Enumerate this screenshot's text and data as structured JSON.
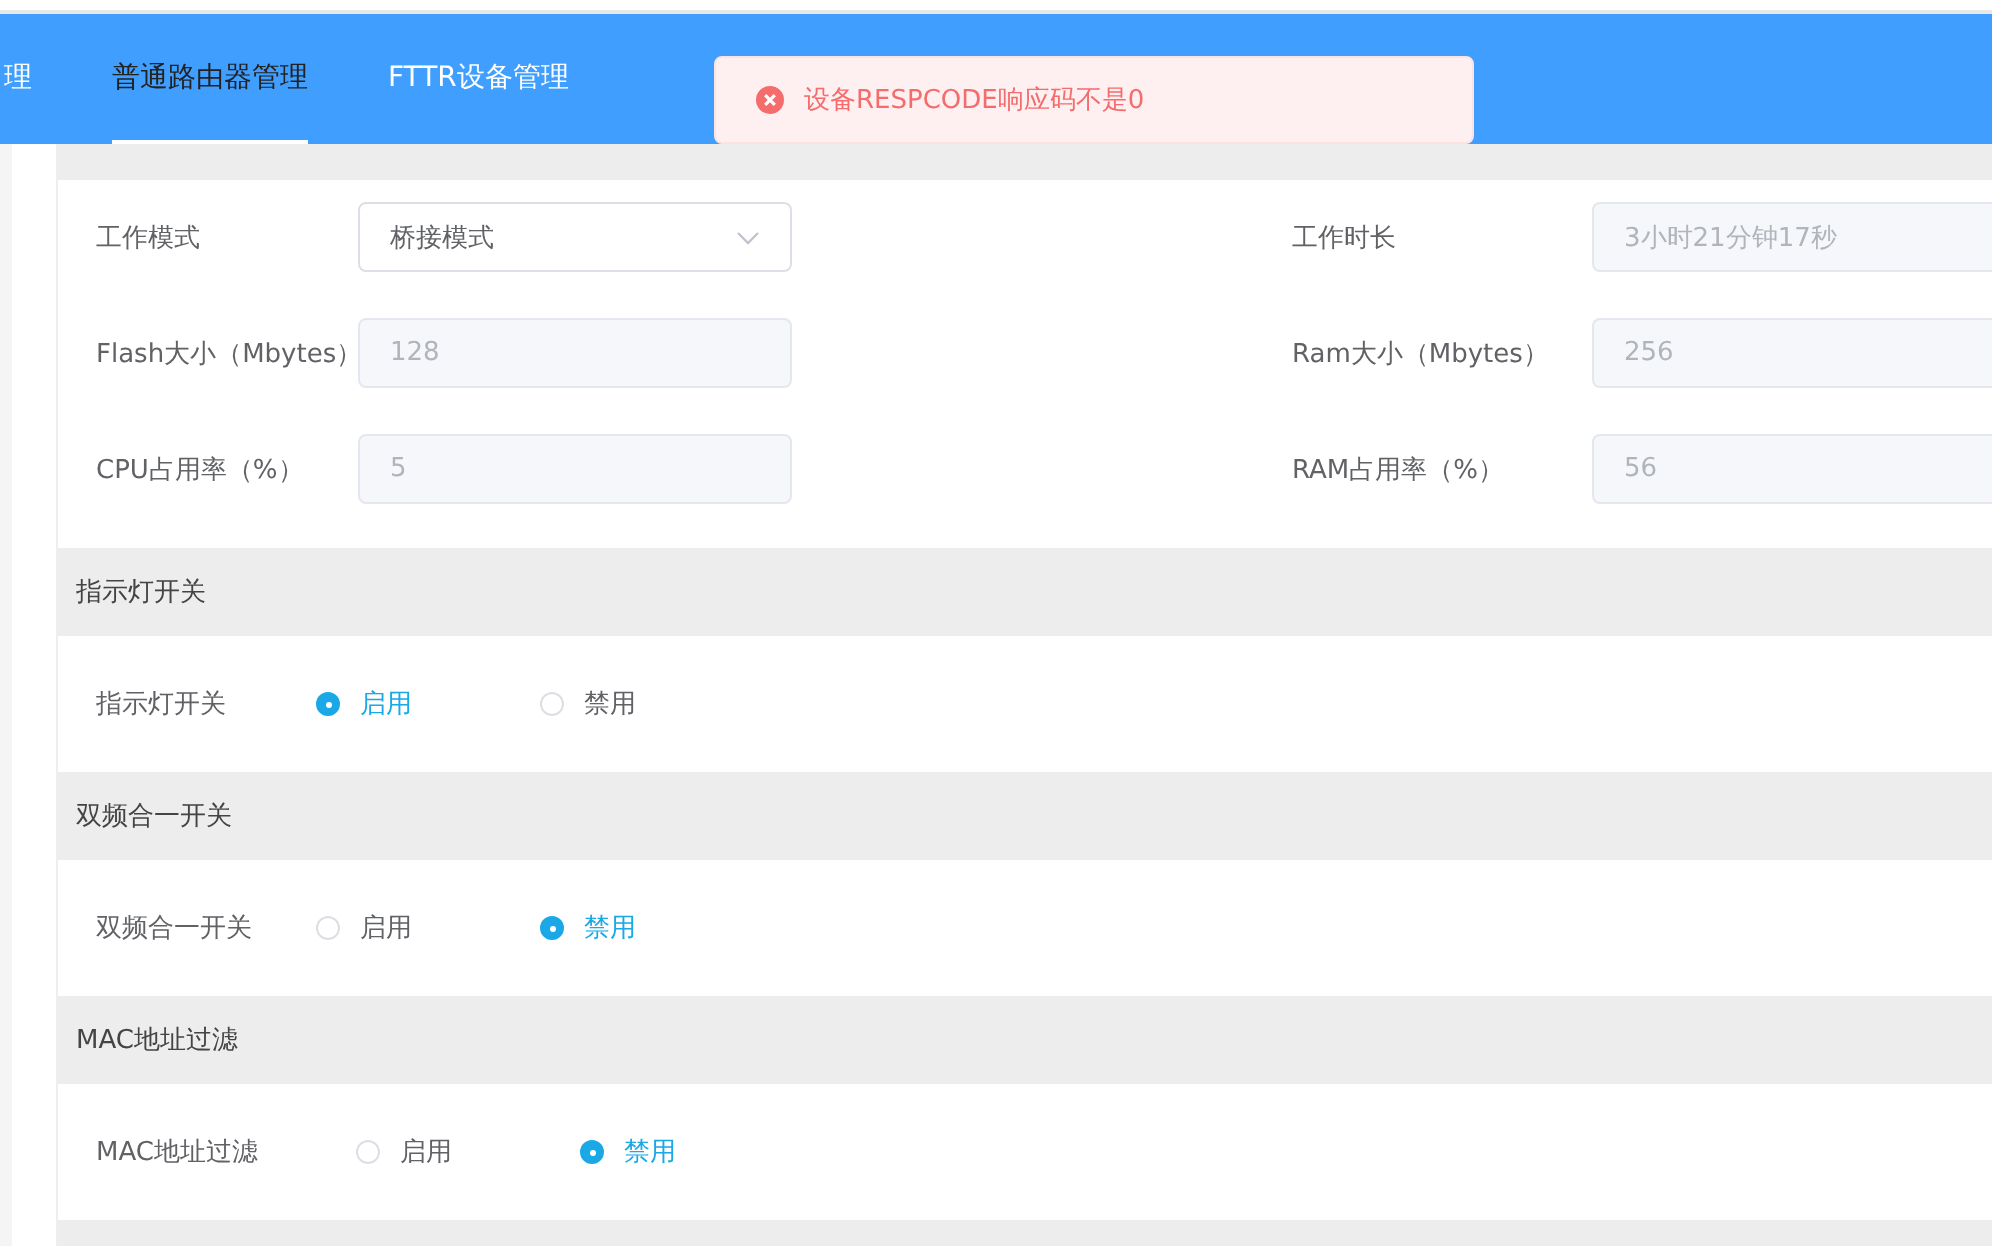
{
  "tabs": [
    {
      "label": "理",
      "selected": false
    },
    {
      "label": "普通路由器管理",
      "selected": true
    },
    {
      "label": "FTTR设备管理",
      "selected": false
    }
  ],
  "toast": {
    "kind": "error",
    "message": "设备RESPCODE响应码不是0"
  },
  "fields": [
    {
      "label": "工作模式",
      "value": "桥接模式",
      "kind": "select",
      "disabled": false
    },
    {
      "label": "工作时长",
      "value": "3小时21分钟17秒",
      "kind": "text",
      "disabled": true
    },
    {
      "label": "Flash大小（Mbytes）",
      "value": "128",
      "kind": "text",
      "disabled": true
    },
    {
      "label": "Ram大小（Mbytes）",
      "value": "256",
      "kind": "text",
      "disabled": true
    },
    {
      "label": "CPU占用率（%）",
      "value": "5",
      "kind": "text",
      "disabled": true
    },
    {
      "label": "RAM占用率（%）",
      "value": "56",
      "kind": "text",
      "disabled": true
    }
  ],
  "sections": [
    {
      "title": "指示灯开关",
      "label": "指示灯开关",
      "options": [
        {
          "label": "启用",
          "selected": true
        },
        {
          "label": "禁用",
          "selected": false
        }
      ]
    },
    {
      "title": "双频合一开关",
      "label": "双频合一开关",
      "options": [
        {
          "label": "启用",
          "selected": false
        },
        {
          "label": "禁用",
          "selected": true
        }
      ]
    },
    {
      "title": "MAC地址过滤",
      "label": "MAC地址过滤",
      "options": [
        {
          "label": "启用",
          "selected": false
        },
        {
          "label": "禁用",
          "selected": true
        }
      ]
    }
  ]
}
